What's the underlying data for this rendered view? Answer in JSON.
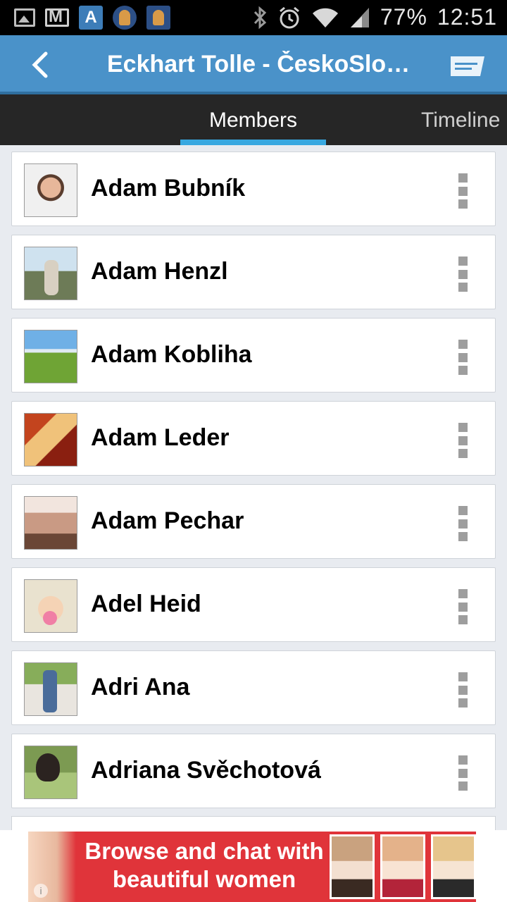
{
  "status_bar": {
    "battery": "77%",
    "time": "12:51",
    "icons": [
      "image-notification-icon",
      "gmail-icon",
      "app-a-icon",
      "owl-app-icon",
      "owl-app-icon",
      "bluetooth-icon",
      "alarm-icon",
      "wifi-icon",
      "signal-icon"
    ]
  },
  "app_bar": {
    "title": "Eckhart Tolle - ČeskoSlo…",
    "back_icon": "back-arrow-icon",
    "message_icon": "message-icon"
  },
  "tabs": [
    {
      "label": "Members",
      "active": true
    },
    {
      "label": "Timeline",
      "active": false
    }
  ],
  "members": [
    {
      "name": "Adam Bubník"
    },
    {
      "name": "Adam Henzl"
    },
    {
      "name": "Adam Kobliha"
    },
    {
      "name": "Adam Leder"
    },
    {
      "name": "Adam Pechar"
    },
    {
      "name": "Adel Heid"
    },
    {
      "name": "Adri Ana"
    },
    {
      "name": "Adriana Svěchotová"
    }
  ],
  "ad": {
    "line1": "Browse and chat with",
    "line2": "beautiful women"
  },
  "colors": {
    "app_bar": "#4a92c9",
    "tab_bar": "#262626",
    "tab_indicator": "#38a8e0",
    "ad_background": "#e0343a"
  }
}
